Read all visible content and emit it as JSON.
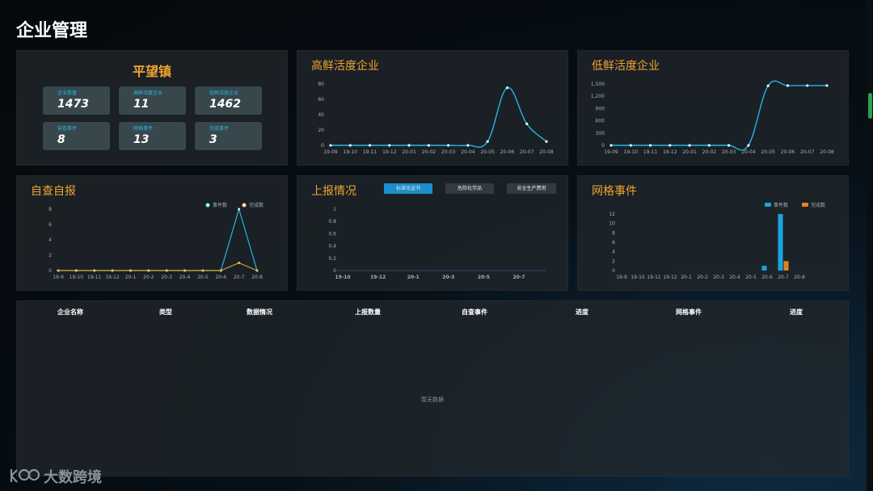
{
  "page": {
    "title": "企业管理"
  },
  "town": {
    "name": "平望镇",
    "stats": [
      {
        "label": "企业数量",
        "value": "1473"
      },
      {
        "label": "高鲜活度企业",
        "value": "11"
      },
      {
        "label": "低鲜活度企业",
        "value": "1462"
      },
      {
        "label": "自查事件",
        "value": "8"
      },
      {
        "label": "网格事件",
        "value": "13"
      },
      {
        "label": "完成事件",
        "value": "3"
      }
    ]
  },
  "panels": {
    "high": {
      "title": "高鲜活度企业"
    },
    "low": {
      "title": "低鲜活度企业"
    },
    "self": {
      "title": "自查自报"
    },
    "report": {
      "title": "上报情况",
      "tabs": [
        "标准化证书",
        "危险化学品",
        "安全生产费用"
      ],
      "active_tab": 0
    },
    "grid": {
      "title": "网格事件"
    }
  },
  "table": {
    "headers": [
      "企业名称",
      "类型",
      "数据情况",
      "上报数量",
      "自查事件",
      "进度",
      "网格事件",
      "进度"
    ],
    "empty_text": "暂无数据"
  },
  "brand": {
    "name": "大数跨境"
  },
  "colors": {
    "accent": "#f0a431",
    "line": "#22b7e8",
    "bar_event": "#1aa3e0",
    "bar_done": "#d9891d"
  },
  "chart_data": [
    {
      "id": "high",
      "type": "line",
      "categories": [
        "19-09",
        "19-10",
        "19-11",
        "19-12",
        "20-01",
        "20-02",
        "20-03",
        "20-04",
        "20-05",
        "20-06",
        "20-07",
        "20-08"
      ],
      "values": [
        0,
        0,
        0,
        0,
        0,
        0,
        0,
        0,
        5,
        75,
        28,
        5
      ],
      "ylim": [
        0,
        80
      ],
      "yticks": [
        0,
        20,
        40,
        60,
        80
      ],
      "smooth": true
    },
    {
      "id": "low",
      "type": "line",
      "categories": [
        "19-09",
        "19-10",
        "19-11",
        "19-12",
        "20-01",
        "20-02",
        "20-03",
        "20-04",
        "20-05",
        "20-06",
        "20-07",
        "20-08"
      ],
      "values": [
        0,
        0,
        0,
        0,
        0,
        0,
        0,
        0,
        1455,
        1460,
        1462,
        1462
      ],
      "ylim": [
        0,
        1500
      ],
      "yticks": [
        "0",
        "300",
        "600",
        "900",
        "1,200",
        "1,500"
      ],
      "smooth": true
    },
    {
      "id": "self",
      "type": "line",
      "categories": [
        "19-9",
        "19-10",
        "19-11",
        "19-12",
        "20-1",
        "20-2",
        "20-3",
        "20-4",
        "20-5",
        "20-6",
        "20-7",
        "20-8"
      ],
      "series": [
        {
          "name": "事件数",
          "values": [
            0,
            0,
            0,
            0,
            0,
            0,
            0,
            0,
            0,
            0,
            8,
            0
          ]
        },
        {
          "name": "完成数",
          "values": [
            0,
            0,
            0,
            0,
            0,
            0,
            0,
            0,
            0,
            0,
            1,
            0
          ]
        }
      ],
      "ylim": [
        0,
        8
      ],
      "yticks": [
        0,
        2,
        4,
        6,
        8
      ],
      "legend": "top-right"
    },
    {
      "id": "report",
      "type": "line",
      "categories": [
        "19-10",
        "19-12",
        "20-1",
        "20-3",
        "20-5",
        "20-7"
      ],
      "values": [],
      "ylim": [
        0,
        1
      ],
      "yticks": [
        "0",
        "0.2",
        "0.4",
        "0.6",
        "0.8",
        "1"
      ]
    },
    {
      "id": "grid",
      "type": "bar",
      "categories": [
        "19-9",
        "19-10",
        "19-11",
        "19-12",
        "20-1",
        "20-2",
        "20-3",
        "20-4",
        "20-5",
        "20-6",
        "20-7",
        "20-8"
      ],
      "series": [
        {
          "name": "事件数",
          "values": [
            0,
            0,
            0,
            0,
            0,
            0,
            0,
            0,
            0,
            1,
            12,
            0
          ]
        },
        {
          "name": "完成数",
          "values": [
            0,
            0,
            0,
            0,
            0,
            0,
            0,
            0,
            0,
            0,
            2,
            0
          ]
        }
      ],
      "ylim": [
        0,
        12
      ],
      "yticks": [
        0,
        2,
        4,
        6,
        8,
        10,
        12
      ],
      "legend": "top-right"
    }
  ]
}
